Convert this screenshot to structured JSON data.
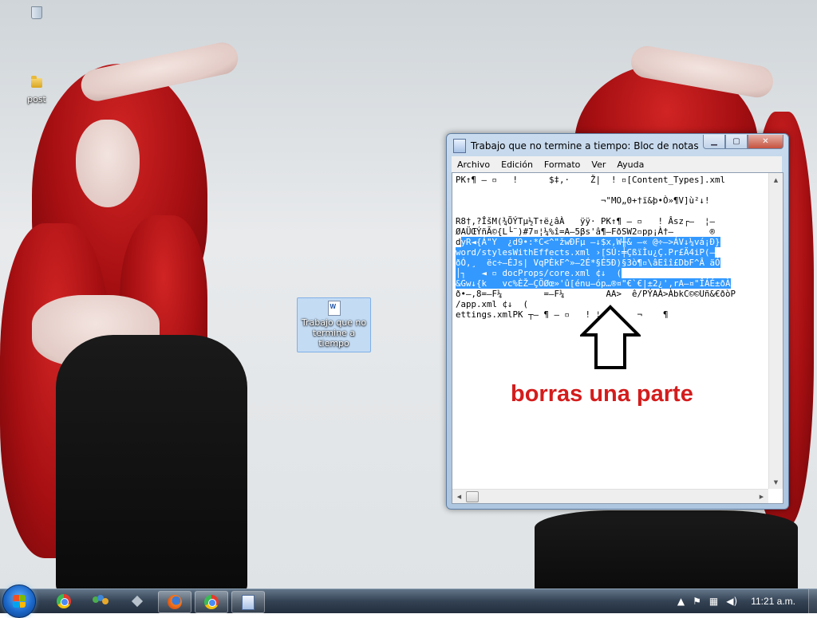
{
  "desktop": {
    "icons": [
      {
        "label": "",
        "icon": "recycle-bin-icon"
      },
      {
        "label": "post",
        "icon": "folder-icon"
      }
    ],
    "selected_icon": {
      "label": "Trabajo que no termine a tiempo",
      "icon": "word-document-icon"
    }
  },
  "notepad": {
    "title": "Trabajo que no termine a tiempo: Bloc de notas",
    "menu": [
      "Archivo",
      "Edición",
      "Formato",
      "Ver",
      "Ayuda"
    ],
    "text_before_selection": "PK↑¶ – ▫   !      $‡,·    Ž|  ! ▫[Content_Types].xml\n\n                            ¬\"MO„0+†ï&þ•Ò»¶V]ù²↓!\n\nR8†,?ÎšM(¾ÕÝTµ½T↑ë¿âÀ   ÿÿ· PK↑¶ – ▫   ! Âsz┌–  ¦–\nØAÜŒÝñÃ©{L└¨)#7¤¦¼%î=A–5βs'â¶–FðSW2▫pp¡À†–       ®\nd",
    "text_selected": "yR◄{Á\"Y  ¿d9•:*C<^\"žwÐFµ –↓$x,W╫& –« @÷–>ÁV↓¼vá¡Ð}\nword/stylesWithEffects.xml ›[SÚ:╪ÇßïÌu¿Ç.Pr£Ä4iP(–\nðÓ,¸  ëc÷–ÉJs| VqPÈkF^»–2É*§É5Ð)§3ò¶▫\\âEîî£DbF^Â äÓ\n│┐   ◄ ▫ docProps/core.xml ¢↓  (\n&Gw↓{k   vc%ÈŽ–ÇÖØœ»'û[énu–óp…®¤\"€`€|±2¿',rA–¤\"ÎÁÉ±ðÀ",
    "text_after_selection": "\nð•–,8=–F¼        =–F¼        AA>  ê/PÝAÀ>ÀbkC©©Uñ&€ðòP\n/app.xml ¢↓  (\nettings.xmlPK ┬– ¶ – ▫   ! ¦ –N·   ¬    ¶"
  },
  "annotation": {
    "text": "borras una parte",
    "color": "#d41c1c"
  },
  "taskbar": {
    "pinned": [
      "chrome-icon",
      "users-icon",
      "diamond-icon",
      "firefox-icon",
      "chrome-icon",
      "notepad-icon"
    ],
    "tray_icons": [
      "show-hidden-icons-icon",
      "flag-icon",
      "network-icon",
      "volume-icon"
    ],
    "clock": "11:21 a.m."
  },
  "colors": {
    "selection": "#3399ff",
    "taskbar": "#2d3c4e",
    "hair": "#c0161b"
  }
}
